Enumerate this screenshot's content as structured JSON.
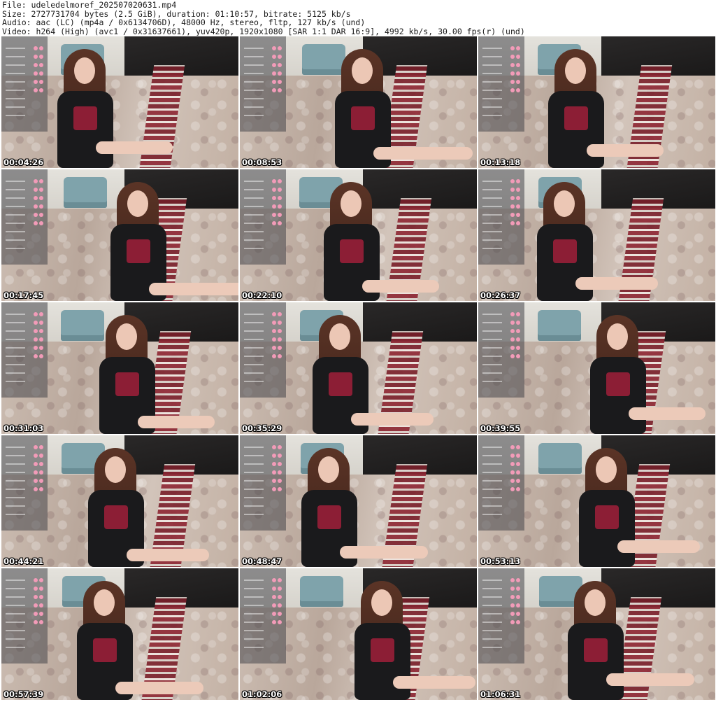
{
  "header": {
    "line1": "File: udeledelmoref_202507020631.mp4",
    "line2": "Size: 2727731704 bytes (2.5 GiB), duration: 01:10:57, bitrate: 5125 kb/s",
    "line3": "Audio: aac (LC) (mp4a / 0x6134706D), 48000 Hz, stereo, fltp, 127 kb/s (und)",
    "line4": "Video: h264 (High) (avc1 / 0x31637661), yuv420p, 1920x1080 [SAR 1:1 DAR 16:9], 4992 kb/s, 30.00 fps(r) (und)"
  },
  "thumbnails": [
    {
      "timestamp": "00:04:26"
    },
    {
      "timestamp": "00:08:53"
    },
    {
      "timestamp": "00:13:18"
    },
    {
      "timestamp": "00:17:45"
    },
    {
      "timestamp": "00:22:10"
    },
    {
      "timestamp": "00:26:37"
    },
    {
      "timestamp": "00:31:03"
    },
    {
      "timestamp": "00:35:29"
    },
    {
      "timestamp": "00:39:55"
    },
    {
      "timestamp": "00:44:21"
    },
    {
      "timestamp": "00:48:47"
    },
    {
      "timestamp": "00:53:13"
    },
    {
      "timestamp": "00:57:39"
    },
    {
      "timestamp": "01:02:06"
    },
    {
      "timestamp": "01:06:31"
    }
  ]
}
